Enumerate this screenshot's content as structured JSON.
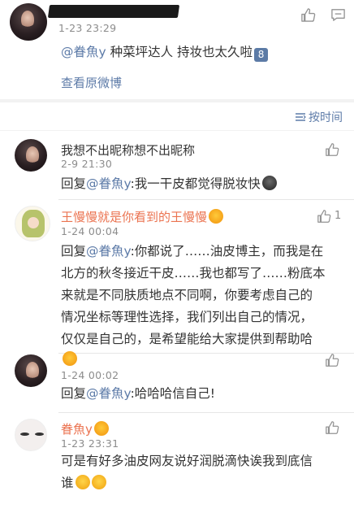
{
  "post": {
    "timestamp": "1-23 23:29",
    "mention": "@眷魚y",
    "text": " 种菜坪达人 持妆也太久啦",
    "badge": "8",
    "view_original": "查看原微博"
  },
  "sort": {
    "label": "按时间"
  },
  "comments": [
    {
      "name": "我想不出昵称想不出昵称",
      "timestamp": "2-9 21:30",
      "reply_prefix": "回复",
      "mention": "@眷魚y",
      "text": ":我一干皮都觉得脱妆快"
    },
    {
      "name": "王慢慢就是你看到的王慢慢",
      "timestamp": "1-24 00:04",
      "like_count": "1",
      "reply_prefix": "回复",
      "mention": "@眷魚y",
      "line1": ":你都说了……油皮博主，而我是在",
      "line2": "北方的秋冬接近干皮……我也都写了……粉底本",
      "line3": "来就是不同肤质地点不同啊，你要考虑自己的",
      "line4": "情况坐标等理性选择，我们列出自己的情况，",
      "line5": "仅仅是自己的，是希望能给大家提供到帮助哈"
    },
    {
      "name": "",
      "timestamp": "1-24 00:02",
      "reply_prefix": "回复",
      "mention": "@眷魚y",
      "text": ":哈哈哈信自己!"
    },
    {
      "name": "眷魚y",
      "timestamp": "1-23 23:31",
      "line1": "可是有好多油皮网友说好润脱滴快诶我到底信",
      "line2": "谁"
    }
  ],
  "icons": {
    "like": "thumbs-up-icon",
    "comment": "comment-icon",
    "sort": "sort-lines-icon"
  },
  "colors": {
    "link": "#5d7ba8",
    "name_orange": "#eb7350",
    "muted": "#8c8c8c"
  }
}
